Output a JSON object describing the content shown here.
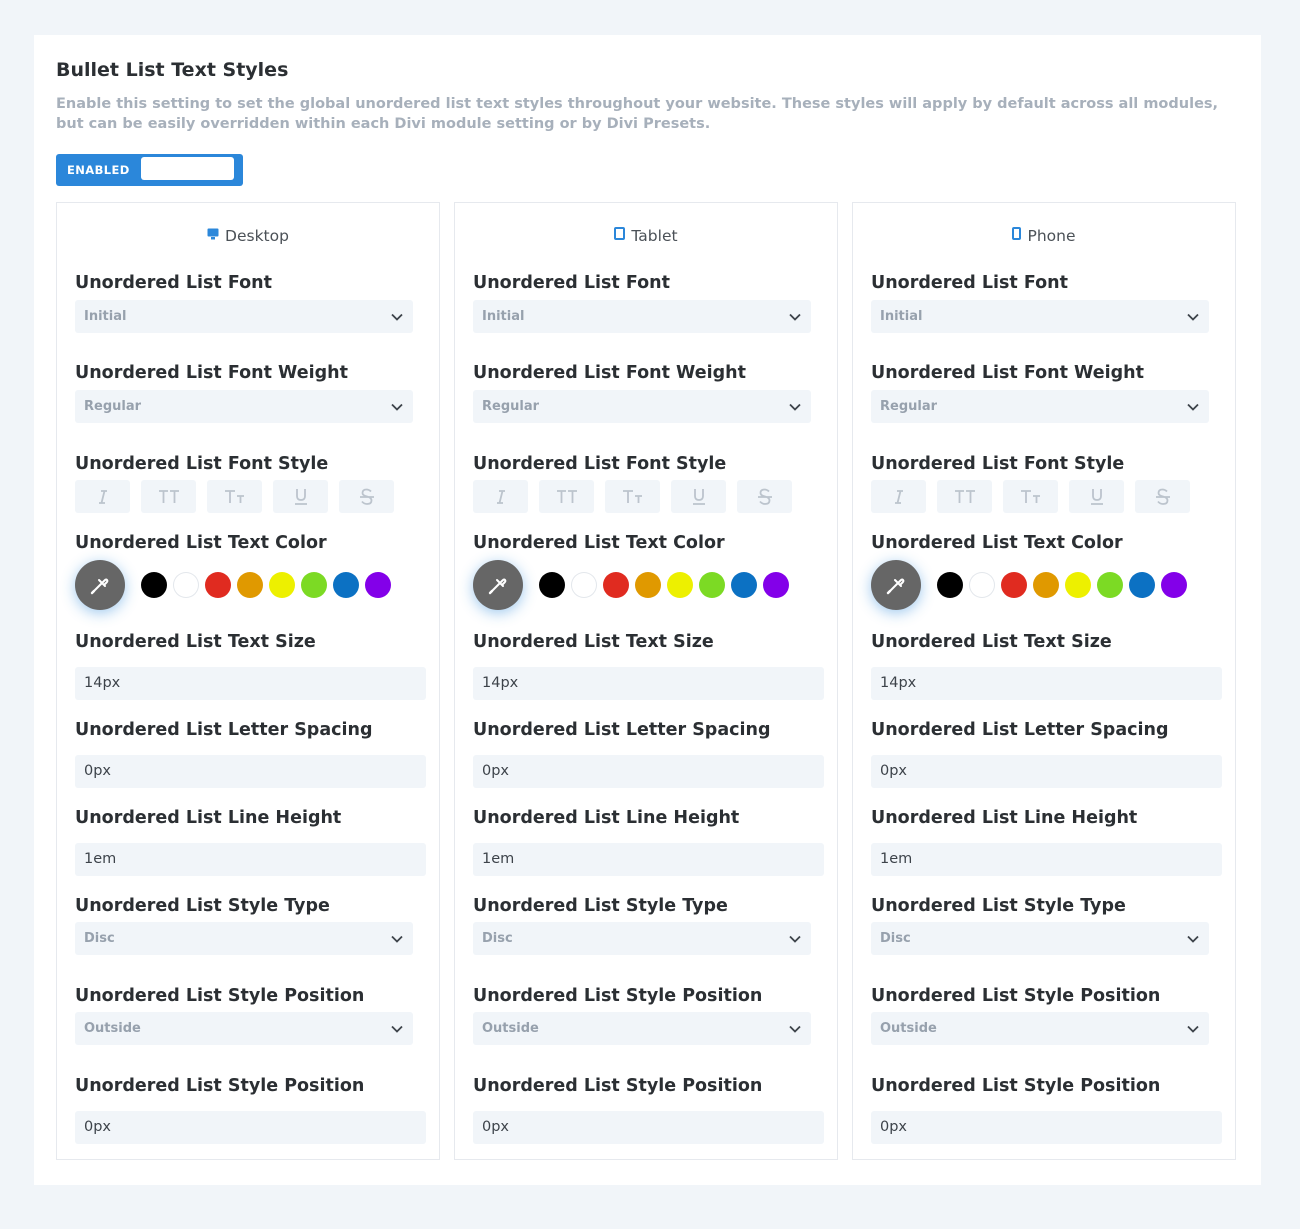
{
  "header": {
    "title": "Bullet List Text Styles",
    "description": "Enable this setting to set the global unordered list text styles throughout your website. These styles will apply by default across all modules, but can be easily overridden within each Divi module setting or by Divi Presets."
  },
  "toggle": {
    "label": "ENABLED",
    "state": true
  },
  "colors": {
    "accent": "#2b87da",
    "picker": "#666666",
    "swatches": [
      "#000000",
      "#ffffff",
      "#e02b20",
      "#e09900",
      "#edf000",
      "#7cda24",
      "#0c71c3",
      "#8300e9"
    ]
  },
  "columns": [
    {
      "device": "Desktop",
      "icon": "desktop-icon",
      "font_label": "Unordered List Font",
      "font_value": "Initial",
      "weight_label": "Unordered List Font Weight",
      "weight_value": "Regular",
      "style_label": "Unordered List Font Style",
      "color_label": "Unordered List Text Color",
      "size_label": "Unordered List Text Size",
      "size_value": "14px",
      "spacing_label": "Unordered List Letter Spacing",
      "spacing_value": "0px",
      "line_height_label": "Unordered List Line Height",
      "line_height_value": "1em",
      "style_type_label": "Unordered List Style Type",
      "style_type_value": "Disc",
      "position_label": "Unordered List Style Position",
      "position_value": "Outside",
      "indent_label": "Unordered List Style Position",
      "indent_value": "0px"
    },
    {
      "device": "Tablet",
      "icon": "tablet-icon",
      "font_label": "Unordered List Font",
      "font_value": "Initial",
      "weight_label": "Unordered List Font Weight",
      "weight_value": "Regular",
      "style_label": "Unordered List Font Style",
      "color_label": "Unordered List Text Color",
      "size_label": "Unordered List Text Size",
      "size_value": "14px",
      "spacing_label": "Unordered List Letter Spacing",
      "spacing_value": "0px",
      "line_height_label": "Unordered List Line Height",
      "line_height_value": "1em",
      "style_type_label": "Unordered List Style Type",
      "style_type_value": "Disc",
      "position_label": "Unordered List Style Position",
      "position_value": "Outside",
      "indent_label": "Unordered List Style Position",
      "indent_value": "0px"
    },
    {
      "device": "Phone",
      "icon": "phone-icon",
      "font_label": "Unordered List Font",
      "font_value": "Initial",
      "weight_label": "Unordered List Font Weight",
      "weight_value": "Regular",
      "style_label": "Unordered List Font Style",
      "color_label": "Unordered List Text Color",
      "size_label": "Unordered List Text Size",
      "size_value": "14px",
      "spacing_label": "Unordered List Letter Spacing",
      "spacing_value": "0px",
      "line_height_label": "Unordered List Line Height",
      "line_height_value": "1em",
      "style_type_label": "Unordered List Style Type",
      "style_type_value": "Disc",
      "position_label": "Unordered List Style Position",
      "position_value": "Outside",
      "indent_label": "Unordered List Style Position",
      "indent_value": "0px"
    }
  ]
}
